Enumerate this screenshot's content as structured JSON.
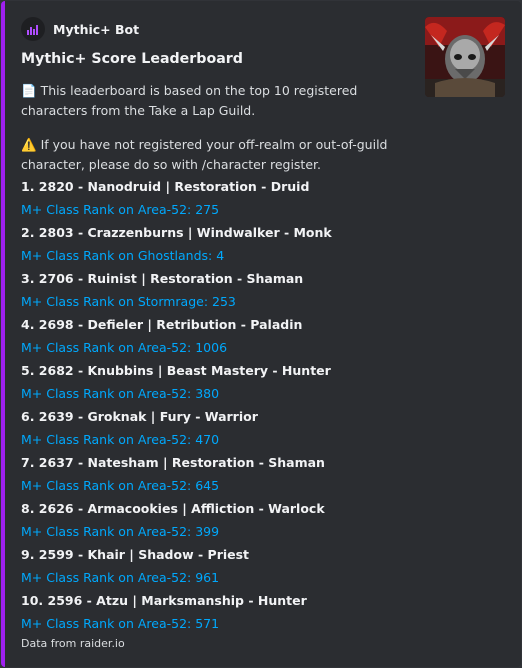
{
  "embed": {
    "author": {
      "name": "Mythic+ Bot",
      "icon": "bar-chart-icon"
    },
    "title": "Mythic+ Score Leaderboard",
    "accent_color": "#a020f0",
    "thumbnail": "wow-character-portrait",
    "description": {
      "line1_emoji": "📄",
      "line1": "This leaderboard is based on the top 10 registered characters from the Take a Lap Guild.",
      "line2_emoji": "⚠️",
      "line2": "If you have not registered your off-realm or out-of-guild character, please do so with /character register."
    },
    "entries": [
      {
        "title": "1. 2820 - Nanodruid | Restoration - Druid",
        "link": "M+ Class Rank on Area-52: 275"
      },
      {
        "title": "2. 2803 - Crazzenburns | Windwalker - Monk",
        "link": "M+ Class Rank on Ghostlands: 4"
      },
      {
        "title": "3. 2706 - Ruinist | Restoration - Shaman",
        "link": "M+ Class Rank on Stormrage: 253"
      },
      {
        "title": "4. 2698 - Defieler | Retribution - Paladin",
        "link": "M+ Class Rank on Area-52: 1006"
      },
      {
        "title": "5. 2682 - Knubbins | Beast Mastery - Hunter",
        "link": "M+ Class Rank on Area-52: 380"
      },
      {
        "title": "6. 2639 - Groknak | Fury - Warrior",
        "link": "M+ Class Rank on Area-52: 470"
      },
      {
        "title": "7. 2637 - Natesham | Restoration - Shaman",
        "link": "M+ Class Rank on Area-52: 645"
      },
      {
        "title": "8. 2626 - Armacookies | Affliction - Warlock",
        "link": "M+ Class Rank on Area-52: 399"
      },
      {
        "title": "9. 2599 - Khair | Shadow - Priest",
        "link": "M+ Class Rank on Area-52: 961"
      },
      {
        "title": "10. 2596 - Atzu | Marksmanship - Hunter",
        "link": "M+ Class Rank on Area-52: 571"
      }
    ],
    "footer": "Data from raider.io"
  }
}
